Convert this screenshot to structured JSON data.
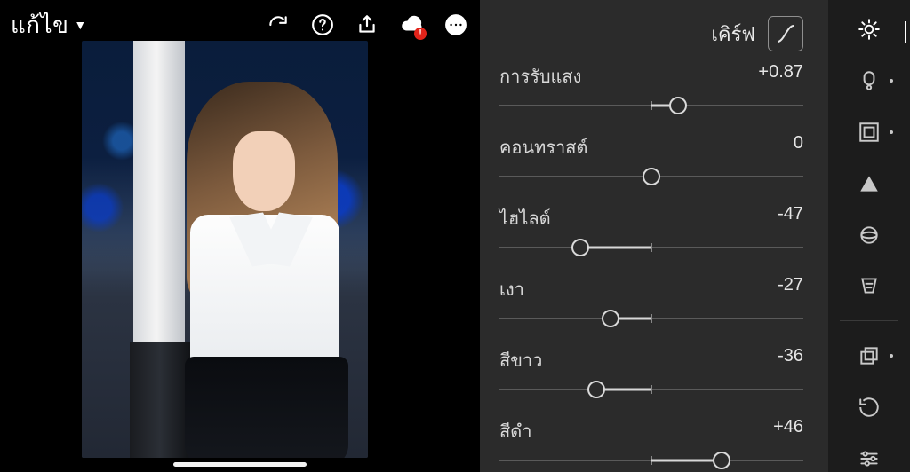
{
  "header": {
    "mode_label": "แก้ไข"
  },
  "panel": {
    "title": "เคิร์ฟ",
    "sliders": [
      {
        "label": "การรับแสง",
        "value": 0.87,
        "display": "+0.87",
        "min": -5,
        "max": 5
      },
      {
        "label": "คอนทราสต์",
        "value": 0,
        "display": "0",
        "min": -100,
        "max": 100
      },
      {
        "label": "ไฮไลต์",
        "value": -47,
        "display": "-47",
        "min": -100,
        "max": 100
      },
      {
        "label": "เงา",
        "value": -27,
        "display": "-27",
        "min": -100,
        "max": 100
      },
      {
        "label": "สีขาว",
        "value": -36,
        "display": "-36",
        "min": -100,
        "max": 100
      },
      {
        "label": "สีดำ",
        "value": 46,
        "display": "+46",
        "min": -100,
        "max": 100
      }
    ]
  },
  "sidebar_tools": [
    {
      "id": "light",
      "active": true
    },
    {
      "id": "color",
      "active": false,
      "dot": true
    },
    {
      "id": "effects",
      "active": false,
      "dot": true
    },
    {
      "id": "detail",
      "active": false
    },
    {
      "id": "optics",
      "active": false
    },
    {
      "id": "geometry",
      "active": false
    },
    {
      "id": "presets",
      "active": false,
      "dot": true
    },
    {
      "id": "versions",
      "active": false
    },
    {
      "id": "adjust",
      "active": false
    }
  ]
}
